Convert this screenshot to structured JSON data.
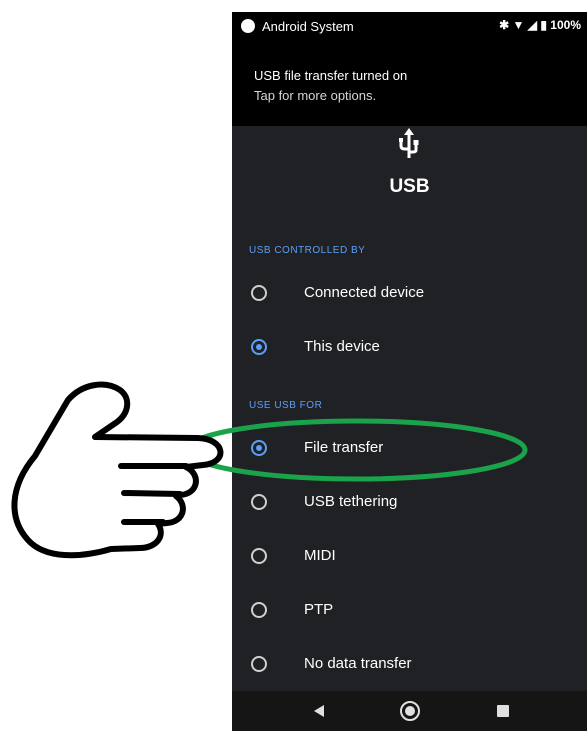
{
  "status_bar": {
    "app_name": "Android System",
    "battery": "100%",
    "icons": [
      "bluetooth-icon",
      "wifi-icon",
      "signal-icon",
      "battery-icon"
    ]
  },
  "notification": {
    "title": "USB file transfer turned on",
    "subtitle": "Tap for more options."
  },
  "dialog": {
    "icon": "usb-icon",
    "title": "USB",
    "controlled_by": {
      "header": "USB CONTROLLED BY",
      "options": [
        {
          "label": "Connected device",
          "selected": false
        },
        {
          "label": "This device",
          "selected": true
        }
      ]
    },
    "use_for": {
      "header": "USE USB FOR",
      "options": [
        {
          "label": "File transfer",
          "selected": true
        },
        {
          "label": "USB tethering",
          "selected": false
        },
        {
          "label": "MIDI",
          "selected": false
        },
        {
          "label": "PTP",
          "selected": false
        },
        {
          "label": "No data transfer",
          "selected": false
        }
      ]
    }
  },
  "nav_bar": [
    "back-button",
    "home-button",
    "recents-button"
  ],
  "annotation": {
    "highlight_color": "#1aa34a",
    "pointer": "pointing-hand-icon"
  },
  "colors": {
    "accent": "#5c9ff8",
    "background": "#202124"
  }
}
